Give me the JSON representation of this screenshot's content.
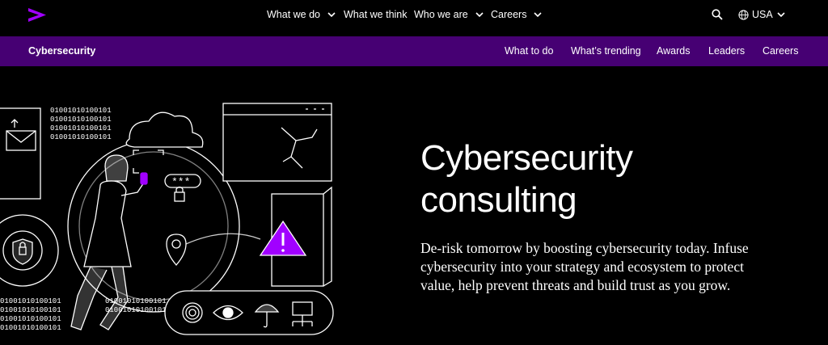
{
  "brand": {
    "accent": "#a100ff",
    "subnav_bg": "#460073"
  },
  "topnav": {
    "items": [
      {
        "label": "What we do",
        "has_dropdown": true
      },
      {
        "label": "What we think",
        "has_dropdown": false
      },
      {
        "label": "Who we are",
        "has_dropdown": true
      },
      {
        "label": "Careers",
        "has_dropdown": true
      }
    ],
    "search_icon": "search-icon",
    "locale": {
      "label": "USA",
      "icon": "globe-icon"
    }
  },
  "subnav": {
    "title": "Cybersecurity",
    "items": [
      {
        "label": "What to do"
      },
      {
        "label": "What’s trending"
      },
      {
        "label": "Awards"
      },
      {
        "label": "Leaders"
      },
      {
        "label": "Careers"
      }
    ]
  },
  "hero": {
    "title_line1": "Cybersecurity",
    "title_line2": "consulting",
    "description": "De-risk tomorrow by boosting cybersecurity today. Infuse cybersecurity into your strategy and ecosystem to protect value, help prevent threats and build trust as you grow.",
    "illustration": {
      "password_mask": "***",
      "binary_rows": [
        "01001010100101",
        "01001010100101",
        "01001010100101",
        "01001010100101"
      ],
      "icons": [
        "mail-icon",
        "shield-gear-icon",
        "cloud-icon",
        "padlock-icon",
        "phone-icon",
        "location-pin-icon",
        "warning-icon",
        "fingerprint-icon",
        "eye-icon",
        "umbrella-icon",
        "network-icon",
        "broken-window-icon",
        "door-icon"
      ]
    }
  }
}
